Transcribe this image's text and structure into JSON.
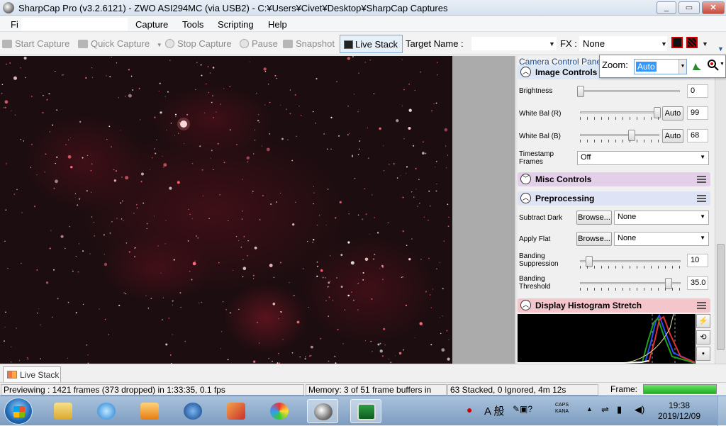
{
  "window": {
    "title": "SharpCap Pro (v3.2.6121) - ZWO ASI294MC (via USB2) - C:¥Users¥Civet¥Desktop¥SharpCap Captures",
    "min": "_",
    "max": "▭",
    "close": "✕"
  },
  "menu": {
    "file": "Fi",
    "capture": "Capture",
    "tools": "Tools",
    "scripting": "Scripting",
    "help": "Help"
  },
  "toolbar": {
    "start_capture": "Start Capture",
    "quick_capture": "Quick Capture",
    "stop_capture": "Stop Capture",
    "pause": "Pause",
    "snapshot": "Snapshot",
    "live_stack": "Live Stack",
    "target_name_label": "Target Name :",
    "target_name_value": "",
    "fx_label": "FX :",
    "fx_value": "None"
  },
  "zoom": {
    "label": "Zoom:",
    "value": "Auto"
  },
  "panel": {
    "header": "Camera Control Pane",
    "image_controls": {
      "title": "Image Controls",
      "brightness_label": "Brightness",
      "brightness_value": "0",
      "white_bal_r_label": "White Bal (R)",
      "white_bal_r_value": "99",
      "white_bal_b_label": "White Bal (B)",
      "white_bal_b_value": "68",
      "auto_label": "Auto",
      "timestamp_label_1": "Timestamp",
      "timestamp_label_2": "Frames",
      "timestamp_value": "Off"
    },
    "misc_controls": {
      "title": "Misc Controls"
    },
    "preprocessing": {
      "title": "Preprocessing",
      "subtract_dark_label": "Subtract Dark",
      "apply_flat_label": "Apply Flat",
      "browse_label": "Browse...",
      "subtract_dark_value": "None",
      "apply_flat_value": "None",
      "banding_suppression_1": "Banding",
      "banding_suppression_2": "Suppression",
      "banding_suppression_value": "10",
      "banding_threshold_1": "Banding",
      "banding_threshold_2": "Threshold",
      "banding_threshold_value": "35.0"
    },
    "histogram": {
      "title": "Display Histogram Stretch"
    }
  },
  "tabs": {
    "live_stack": "Live Stack"
  },
  "status": {
    "previewing": "Previewing : 1421 frames (373 dropped) in 1:33:35, 0.1 fps",
    "memory": "Memory: 3 of 51 frame buffers in",
    "stacked": "63 Stacked, 0 Ignored, 4m 12s",
    "frame_label": "Frame:",
    "frame_progress": 1.0
  },
  "tray": {
    "ime": "A 般",
    "caps": "CAPS",
    "kana": "KANA",
    "time": "19:38",
    "date": "2019/12/09"
  },
  "colors": {
    "image_controls_header": "#dce6f5",
    "misc_controls_header": "#e3cfe8",
    "preprocessing_header": "#dfe3f6",
    "histogram_header": "#f4c6cc",
    "frame_progress": "#2ec12e"
  }
}
